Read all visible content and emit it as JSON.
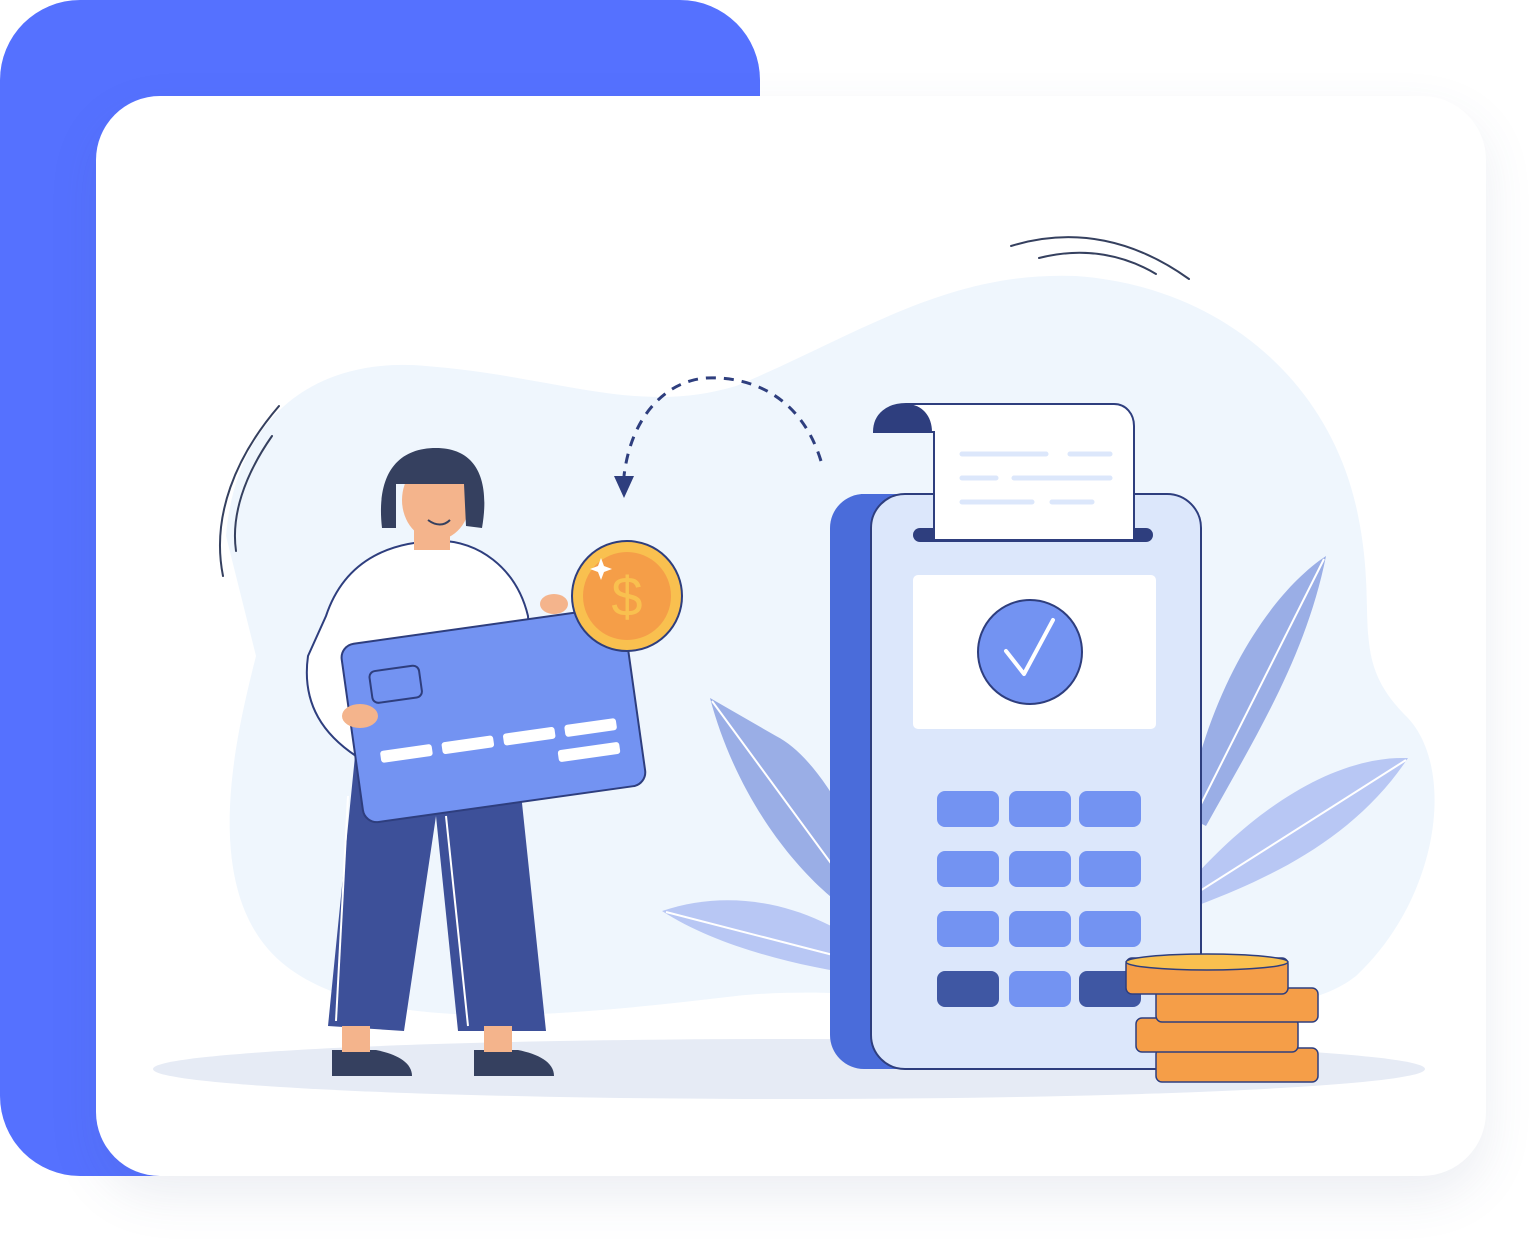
{
  "colors": {
    "accent": "#5571FF",
    "card_background": "#FFFFFF",
    "blob": "#EFF6FD",
    "ground_shadow": "#E6EBF5",
    "navy": "#3D5099",
    "navy_dark": "#2E3E7E",
    "hair": "#35405F",
    "skin": "#F4B48C",
    "credit_card": "#7393F2",
    "coin": "#F59E48",
    "coin_light": "#F9C04F",
    "terminal_body": "#DCE7FB",
    "terminal_side": "#4A6CDA",
    "key_blue": "#7393F2",
    "key_dark": "#3F57A3",
    "check_circle": "#7393F2",
    "leaf_dark": "#9AAEE6",
    "leaf_light": "#B8C7F4"
  },
  "illustration": {
    "currency_symbol": "$",
    "icons": [
      "credit-card-icon",
      "dollar-coin-icon",
      "payment-terminal-icon",
      "receipt-icon",
      "checkmark-icon",
      "coin-stack-icon",
      "dashed-arrow-icon"
    ]
  }
}
